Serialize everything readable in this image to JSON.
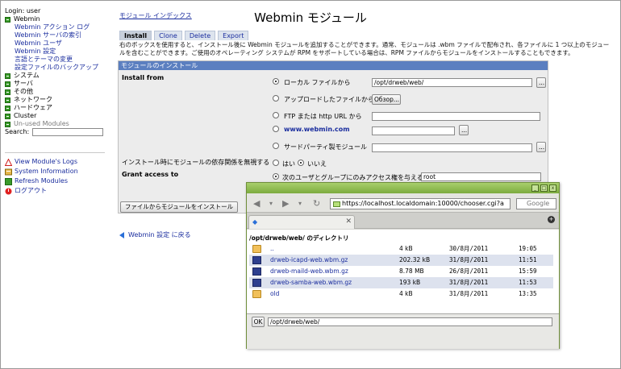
{
  "nav": {
    "login": "Login: user",
    "webmin": "Webmin",
    "webmin_items": [
      "Webmin アクション ログ",
      "Webmin サーバの索引",
      "Webmin ユーザ",
      "Webmin 設定",
      "言語とテーマの変更",
      "設定ファイルのバックアップ"
    ],
    "categories": [
      "システム",
      "サーバ",
      "その他",
      "ネットワーク",
      "ハードウェア",
      "Cluster"
    ],
    "unused": "Un-used Modules",
    "search_label": "Search:",
    "actions": [
      "View Module's Logs",
      "System Information",
      "Refresh Modules",
      "ログアウト"
    ]
  },
  "main": {
    "index_link": "モジュール インデックス",
    "title": "Webmin モジュール",
    "tabs": [
      "Install",
      "Clone",
      "Delete",
      "Export"
    ],
    "description": "右のボックスを使用すると、インストール後に Webmin モジュールを追加することができます。通常、モジュールは .wbm ファイルで配布され、各ファイルに 1 つ以上のモジュールを含むことができます。ご使用のオペレーティング システムが RPM をサポートしている場合は、RPM ファイルからモジュールをインストールすることもできます。",
    "panel_title": "モジュールのインストール",
    "install_from": "Install from",
    "opt_local": "ローカル ファイルから",
    "local_value": "/opt/drweb/web/",
    "opt_upload": "アップロードしたファイルから",
    "browse": "Обзор...",
    "opt_ftp": "FTP または http URL から",
    "opt_webmin": "www.webmin.com",
    "opt_third": "サードパーティ製モジュール",
    "dots": "...",
    "ignore_deps": "インストール時にモジュールの依存関係を無視する",
    "yes": "はい",
    "no": "いいえ",
    "grant_access": "Grant access to",
    "grant_opt": "次のユーザとグループにのみアクセス権を与える",
    "grant_value": "root",
    "install_button": "ファイルからモジュールをインストール",
    "back_link": "Webmin 設定 に戻る"
  },
  "popup": {
    "url": "https://localhost.localdomain:10000/chooser.cgi?a",
    "search_placeholder": "Google",
    "dir_title": "/opt/drweb/web/ のディレクトリ",
    "files": [
      {
        "name": "..",
        "size": "4 kB",
        "date": "30/8月/2011",
        "time": "19:05",
        "type": "folder"
      },
      {
        "name": "drweb-icapd-web.wbm.gz",
        "size": "202.32 kB",
        "date": "31/8月/2011",
        "time": "11:51",
        "type": "file"
      },
      {
        "name": "drweb-maild-web.wbm.gz",
        "size": "8.78 MB",
        "date": "26/8月/2011",
        "time": "15:59",
        "type": "file"
      },
      {
        "name": "drweb-samba-web.wbm.gz",
        "size": "193 kB",
        "date": "31/8月/2011",
        "time": "11:53",
        "type": "file"
      },
      {
        "name": "old",
        "size": "4 kB",
        "date": "31/8月/2011",
        "time": "13:35",
        "type": "folder"
      }
    ],
    "ok": "OK",
    "path_value": "/opt/drweb/web/"
  }
}
